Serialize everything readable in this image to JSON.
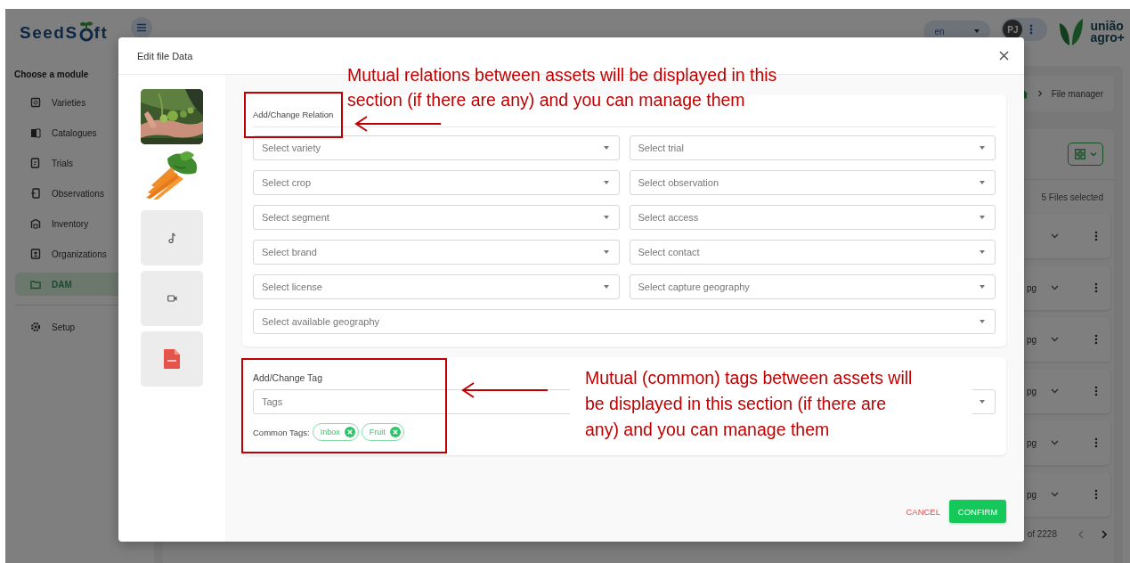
{
  "app": {
    "logo": {
      "left": "SeedS",
      "right": "ft"
    },
    "menu_heading": "Choose a module",
    "modules": [
      {
        "label": "Varieties",
        "kind": "varieties",
        "selected": false
      },
      {
        "label": "Catalogues",
        "kind": "catalogues",
        "selected": false
      },
      {
        "label": "Trials",
        "kind": "trials",
        "selected": false
      },
      {
        "label": "Observations",
        "kind": "observations",
        "selected": false
      },
      {
        "label": "Inventory",
        "kind": "inventory",
        "selected": false
      },
      {
        "label": "Organizations",
        "kind": "organizations",
        "selected": false
      },
      {
        "label": "DAM",
        "kind": "dam",
        "selected": true
      },
      {
        "label": "Setup",
        "kind": "setup",
        "selected": false
      }
    ],
    "language": "en",
    "avatar_initials": "PJ",
    "partner_logo": {
      "line1": "união",
      "line2": "agro+"
    },
    "breadcrumb": "File manager",
    "selection_count": "5 Files selected",
    "file_rows": [
      {
        "expanded": false
      },
      {
        "name": "pg",
        "expanded": false
      },
      {
        "name": "pg",
        "expanded": false
      },
      {
        "name": "pg",
        "expanded": false
      },
      {
        "name": "pg",
        "expanded": false
      },
      {
        "name": "pg",
        "expanded": false
      }
    ],
    "pager": "of 2228"
  },
  "modal": {
    "title": "Edit file Data",
    "thumbnails": [
      {
        "kind": "picture"
      },
      {
        "kind": "picture"
      },
      {
        "kind": "audio"
      },
      {
        "kind": "video"
      },
      {
        "kind": "pdf"
      }
    ],
    "relation": {
      "heading": "Add/Change Relation",
      "selects": [
        {
          "placeholder": "Select variety",
          "full_width": false
        },
        {
          "placeholder": "Select trial",
          "full_width": false
        },
        {
          "placeholder": "Select crop",
          "full_width": false
        },
        {
          "placeholder": "Select observation",
          "full_width": false
        },
        {
          "placeholder": "Select segment",
          "full_width": false
        },
        {
          "placeholder": "Select access",
          "full_width": false
        },
        {
          "placeholder": "Select brand",
          "full_width": false
        },
        {
          "placeholder": "Select contact",
          "full_width": false
        },
        {
          "placeholder": "Select license",
          "full_width": false
        },
        {
          "placeholder": "Select capture geography",
          "full_width": false
        },
        {
          "placeholder": "Select available geography",
          "full_width": true
        }
      ]
    },
    "tags": {
      "heading": "Add/Change Tag",
      "placeholder": "Tags",
      "common_label": "Common Tags:",
      "chips": [
        "Inbox",
        "Fruit"
      ]
    },
    "buttons": {
      "cancel": "CANCEL",
      "confirm": "CONFIRM"
    }
  },
  "annotations": [
    {
      "kind": "relations",
      "text": "Mutual relations between assets will be displayed in this\nsection (if there are any) and you can manage them"
    },
    {
      "kind": "tags",
      "text": "Mutual (common) tags between assets will\nbe displayed in this section (if there are\nany) and you can manage them"
    }
  ]
}
